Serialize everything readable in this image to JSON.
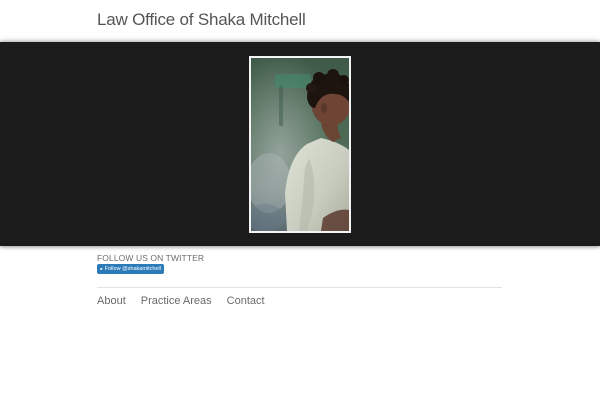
{
  "header": {
    "title": "Law Office of Shaka Mitchell"
  },
  "hero": {
    "image_alt": "Portrait of Shaka Mitchell"
  },
  "social": {
    "follow_label": "FOLLOW US ON TWITTER",
    "button_label": "Follow @shakamitchell",
    "icon": "twitter-bird-icon",
    "button_color": "#2b7bb9"
  },
  "nav": {
    "items": [
      {
        "label": "About"
      },
      {
        "label": "Practice Areas"
      },
      {
        "label": "Contact"
      }
    ]
  },
  "colors": {
    "hero_background": "#1b1b1b",
    "text": "#555555"
  }
}
